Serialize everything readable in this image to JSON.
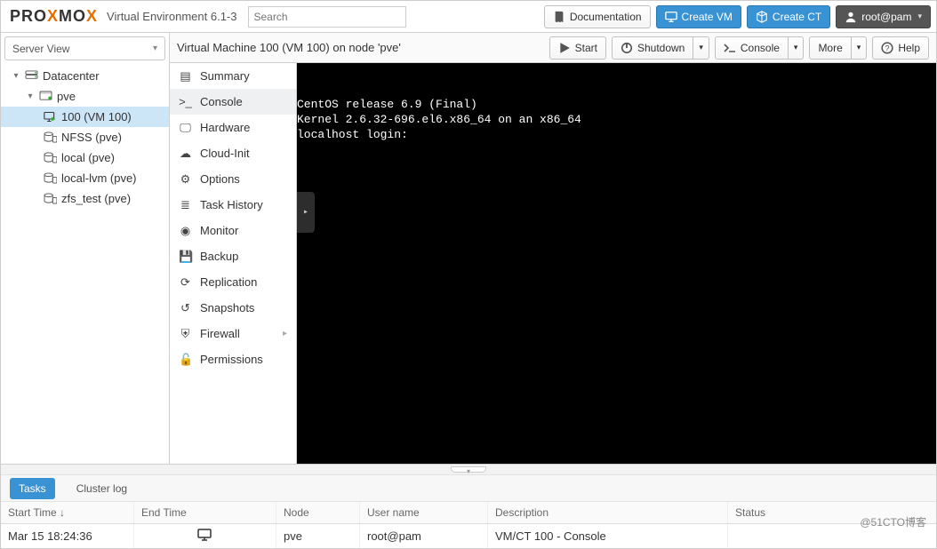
{
  "header": {
    "brand_black": "PRO",
    "brand_orange": "X",
    "brand_black2": "MO",
    "brand_orange2": "X",
    "ve_label": "Virtual Environment 6.1-3",
    "search_placeholder": "Search",
    "doc_label": "Documentation",
    "create_vm_label": "Create VM",
    "create_ct_label": "Create CT",
    "user_label": "root@pam"
  },
  "left": {
    "view_label": "Server View",
    "tree": {
      "datacenter": "Datacenter",
      "node": "pve",
      "vm": "100 (VM 100)",
      "storages": [
        "NFSS (pve)",
        "local (pve)",
        "local-lvm (pve)",
        "zfs_test (pve)"
      ]
    }
  },
  "vm": {
    "title": "Virtual Machine 100 (VM 100) on node 'pve'",
    "buttons": {
      "start": "Start",
      "shutdown": "Shutdown",
      "console": "Console",
      "more": "More",
      "help": "Help"
    },
    "menu": [
      "Summary",
      "Console",
      "Hardware",
      "Cloud-Init",
      "Options",
      "Task History",
      "Monitor",
      "Backup",
      "Replication",
      "Snapshots",
      "Firewall",
      "Permissions"
    ],
    "menu_selected": 1,
    "console_lines": [
      "CentOS release 6.9 (Final)",
      "Kernel 2.6.32-696.el6.x86_64 on an x86_64",
      "",
      "localhost login:"
    ]
  },
  "log": {
    "tabs": {
      "tasks": "Tasks",
      "cluster": "Cluster log"
    },
    "columns": {
      "start": "Start Time",
      "end": "End Time",
      "node": "Node",
      "user": "User name",
      "desc": "Description",
      "status": "Status"
    },
    "row": {
      "start": "Mar 15 18:24:36",
      "end_running": true,
      "node": "pve",
      "user": "root@pam",
      "desc": "VM/CT 100 - Console",
      "status": ""
    }
  },
  "watermark": "@51CTO博客"
}
